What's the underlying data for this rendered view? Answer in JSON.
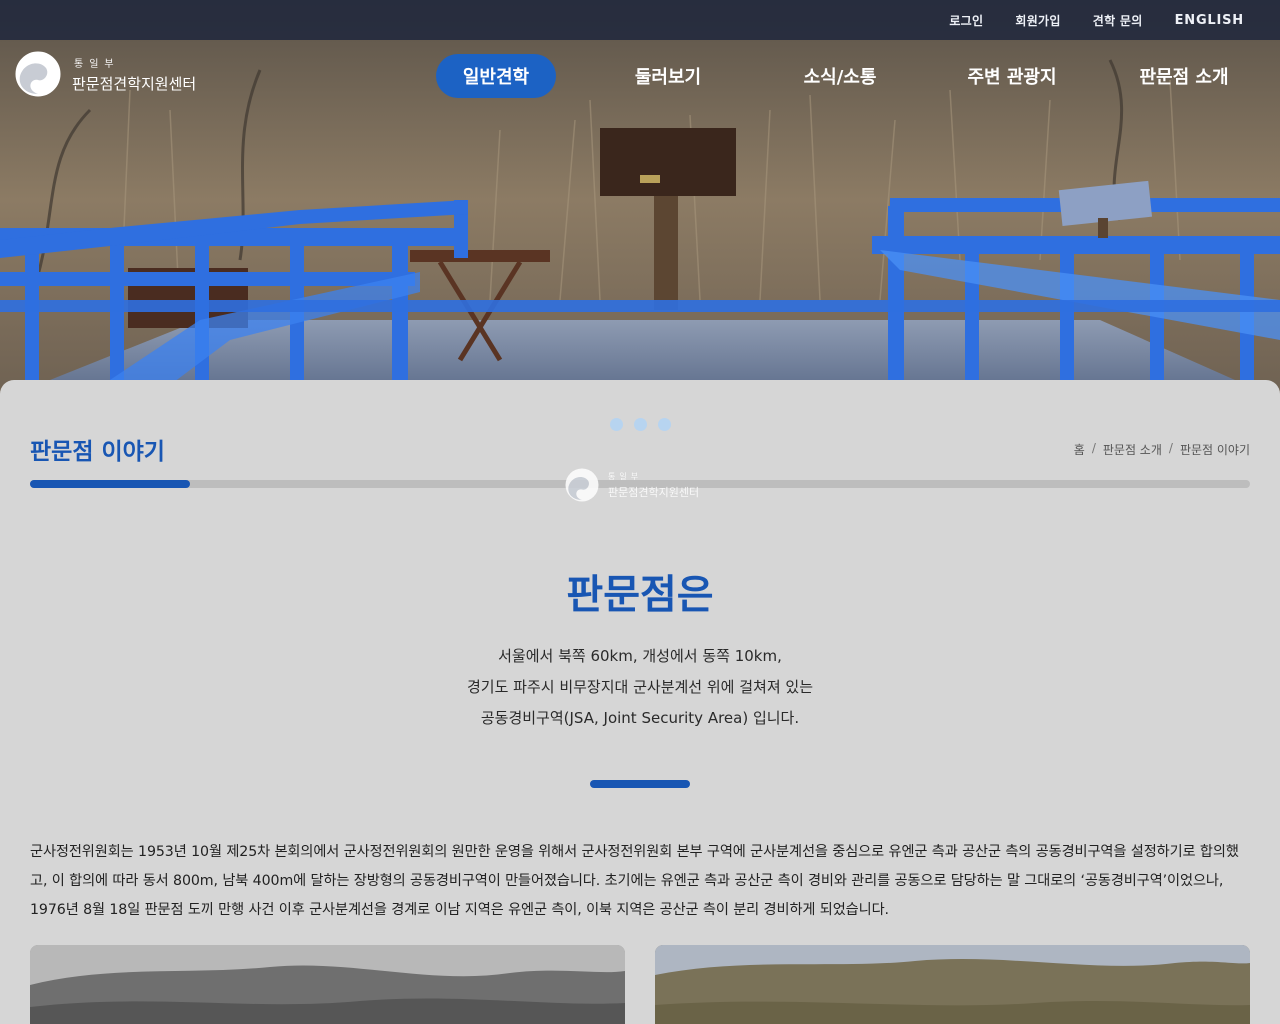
{
  "header": {
    "util_links": [
      "로그인",
      "회원가입",
      "견학 문의",
      "ENGLISH"
    ],
    "logo": {
      "ministry": "통일부",
      "center": "판문점견학지원센터"
    },
    "nav": [
      {
        "label": "일반견학",
        "active": true
      },
      {
        "label": "둘러보기",
        "active": false
      },
      {
        "label": "소식/소통",
        "active": false
      },
      {
        "label": "주변 관광지",
        "active": false
      },
      {
        "label": "판문점 소개",
        "active": false
      }
    ]
  },
  "page": {
    "title": "판문점 이야기",
    "breadcrumb": [
      "홈",
      "판문점 소개",
      "판문점 이야기"
    ]
  },
  "section": {
    "heading": "판문점은",
    "intro": [
      "서울에서 북쪽 60km, 개성에서 동쪽 10km,",
      "경기도 파주시 비무장지대 군사분계선 위에 걸쳐져 있는",
      "공동경비구역(JSA, Joint Security Area) 입니다."
    ],
    "body": "군사정전위원회는 1953년 10월 제25차 본회의에서 군사정전위원회의 원만한 운영을 위해서 군사정전위원회 본부 구역에 군사분계선을 중심으로 유엔군 측과 공산군 측의 공동경비구역을 설정하기로 합의했고, 이 합의에 따라 동서 800m, 남북 400m에 달하는 장방형의 공동경비구역이 만들어졌습니다. 초기에는 유엔군 측과 공산군 측이 경비와 관리를 공동으로 담당하는 말 그대로의 ‘공동경비구역’이었으나, 1976년 8월 18일 판문점 도끼 만행 사건 이후 군사분계선을 경계로 이남 지역은 유엔군 측이, 이북 지역은 공산군 측이 분리 경비하게 되었습니다."
  },
  "colors": {
    "accent": "#1856b3",
    "nav_active": "#1c62c4",
    "railing": "#2f6fe0"
  }
}
